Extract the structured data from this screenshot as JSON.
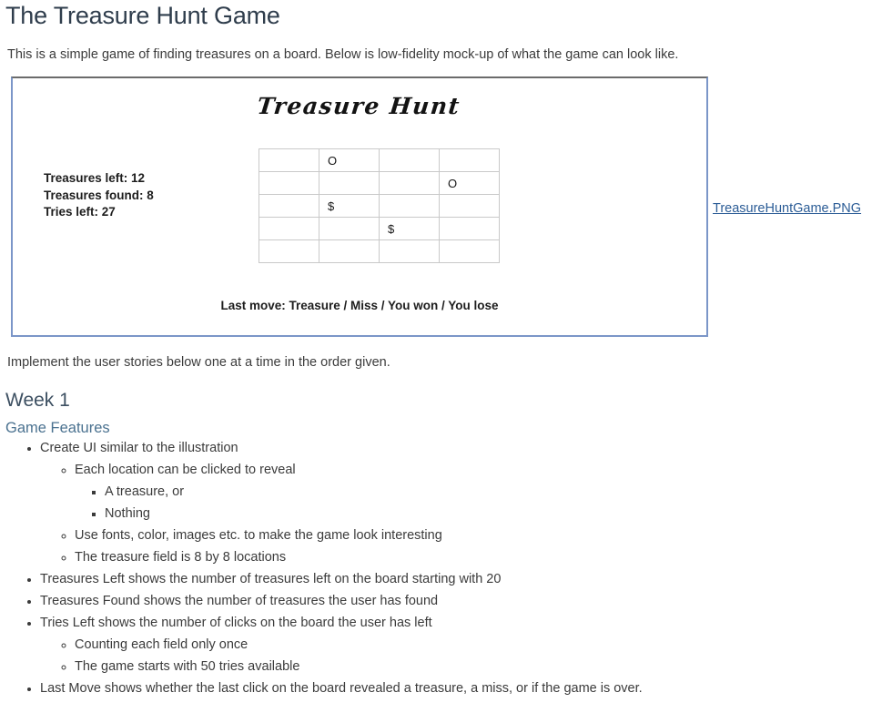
{
  "page": {
    "title": "The Treasure Hunt Game",
    "intro": "This is a simple game of finding treasures on a board. Below is low-fidelity mock-up of what the game can look like.",
    "implement_note": "Implement the user stories below one at a time in the order given."
  },
  "mockup": {
    "title": "Treasure Hunt",
    "stats": {
      "treasures_left": "Treasures left: 12",
      "treasures_found": "Treasures found: 8",
      "tries_left": "Tries left: 27"
    },
    "board": {
      "rows": 5,
      "cols": 4,
      "cells": [
        [
          "",
          "O",
          "",
          ""
        ],
        [
          "",
          "",
          "",
          "O"
        ],
        [
          "",
          "$",
          "",
          ""
        ],
        [
          "",
          "",
          "$",
          ""
        ],
        [
          "",
          "",
          "",
          ""
        ]
      ]
    },
    "last_move": "Last move: Treasure / Miss / You won / You lose",
    "border_color": "#7b96c8"
  },
  "attachment": {
    "link_text": "TreasureHuntGame.PNG",
    "link_color": "#2b5c96"
  },
  "week_section": {
    "heading": "Week 1",
    "subheading": "Game Features",
    "heading_color": "#3c4f61",
    "subheading_color": "#4b7290",
    "items": [
      {
        "text": "Create UI similar to the illustration",
        "children": [
          {
            "text": "Each location can be clicked to reveal",
            "children": [
              {
                "text": "A treasure, or"
              },
              {
                "text": "Nothing"
              }
            ]
          },
          {
            "text": "Use fonts, color, images etc. to make the game look interesting"
          },
          {
            "text": "The treasure field is 8 by 8 locations"
          }
        ]
      },
      {
        "text": "Treasures Left shows the number of treasures left on the board starting with 20"
      },
      {
        "text": "Treasures Found shows the number of treasures the user has found"
      },
      {
        "text": "Tries Left shows the number of clicks on the board the user has left",
        "children": [
          {
            "text": "Counting each field only once"
          },
          {
            "text": "The game starts with 50 tries available"
          }
        ]
      },
      {
        "text": "Last Move shows whether the last click on the board revealed a treasure, a miss, or if the game is over."
      }
    ]
  }
}
